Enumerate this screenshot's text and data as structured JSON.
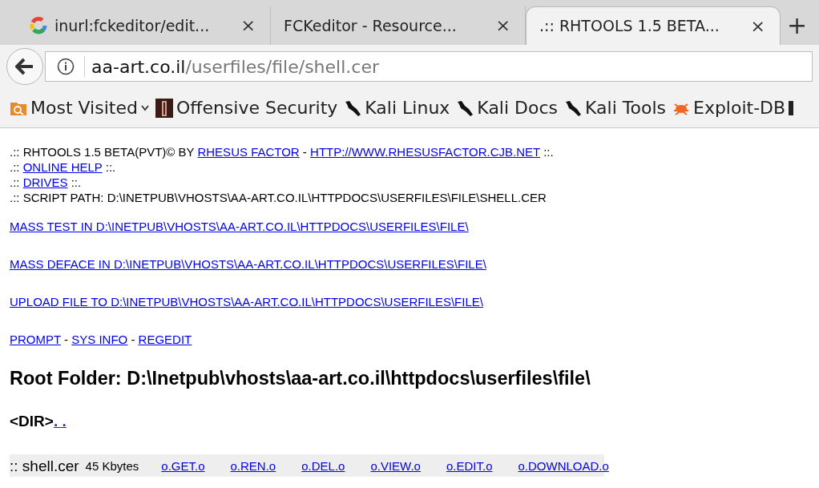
{
  "tabs": [
    {
      "title": "inurl:fckeditor/edit...",
      "kind": "ring",
      "close": "×",
      "selected": false
    },
    {
      "title": "FCKeditor - Resource...",
      "kind": "plain",
      "close": "×",
      "selected": false
    },
    {
      "title": ".:: RHTOOLS 1.5 BETA...",
      "kind": "plain",
      "close": "×",
      "selected": true
    }
  ],
  "new_tab": "+",
  "address_bar": {
    "host": "aa-art.co.il",
    "path": "/userfiles/file/shell.cer"
  },
  "bookmarks": [
    {
      "label": "Most Visited",
      "kind": "folder"
    },
    {
      "label": "Offensive Security",
      "kind": "thumbnail"
    },
    {
      "label": "Kali Linux",
      "kind": "dragon"
    },
    {
      "label": "Kali Docs",
      "kind": "dragon"
    },
    {
      "label": "Kali Tools",
      "kind": "dragon"
    },
    {
      "label": "Exploit-DB",
      "kind": "bug"
    }
  ],
  "page": {
    "header_lines": [
      [
        {
          "kind": "text",
          "text": ".:: RHTOOLS 1.5 BETA(PVT)© BY "
        },
        {
          "kind": "link",
          "text": "RHESUS FACTOR",
          "visited": false
        },
        {
          "kind": "text",
          "text": " - "
        },
        {
          "kind": "link",
          "text": "HTTP://WWW.RHESUSFACTOR.CJB.NET",
          "visited": false
        },
        {
          "kind": "text",
          "text": " ::."
        }
      ],
      [
        {
          "kind": "text",
          "text": ".:: "
        },
        {
          "kind": "link",
          "text": "ONLINE HELP",
          "visited": false
        },
        {
          "kind": "text",
          "text": " ::."
        }
      ],
      [
        {
          "kind": "text",
          "text": ".:: "
        },
        {
          "kind": "link",
          "text": "DRIVES",
          "visited": false
        },
        {
          "kind": "text",
          "text": " ::."
        }
      ],
      [
        {
          "kind": "text",
          "text": ".:: SCRIPT PATH: D:\\INETPUB\\VHOSTS\\AA-ART.CO.IL\\HTTPDOCS\\USERFILES\\FILE\\SHELL.CER"
        }
      ]
    ],
    "action_links": [
      {
        "text": "MASS TEST IN D:\\INETPUB\\VHOSTS\\AA-ART.CO.IL\\HTTPDOCS\\USERFILES\\FILE\\",
        "visited": false
      },
      {
        "text": "MASS DEFACE IN D:\\INETPUB\\VHOSTS\\AA-ART.CO.IL\\HTTPDOCS\\USERFILES\\FILE\\",
        "visited": false
      },
      {
        "text": "UPLOAD FILE TO D:\\INETPUB\\VHOSTS\\AA-ART.CO.IL\\HTTPDOCS\\USERFILES\\FILE\\",
        "visited": false
      }
    ],
    "tool_links": [
      {
        "kind": "link",
        "text": "PROMPT",
        "visited": false
      },
      {
        "kind": "text",
        "text": " - "
      },
      {
        "kind": "link",
        "text": "SYS INFO",
        "visited": false
      },
      {
        "kind": "text",
        "text": " - "
      },
      {
        "kind": "link",
        "text": "REGEDIT",
        "visited": false
      }
    ],
    "root_folder": "Root Folder: D:\\Inetpub\\vhosts\\aa-art.co.il\\httpdocs\\userfiles\\file\\",
    "dir_entry": {
      "label": "<DIR>",
      "link": ". .",
      "visited": true
    },
    "files": [
      {
        "name": ":: shell.cer",
        "size": "45 Kbytes",
        "actions": [
          {
            "text": "o.GET.o",
            "visited": false
          },
          {
            "text": "o.REN.o",
            "visited": false
          },
          {
            "text": "o.DEL.o",
            "visited": false
          },
          {
            "text": "o.VIEW.o",
            "visited": false
          },
          {
            "text": "o.EDIT.o",
            "visited": false
          },
          {
            "text": "o.DOWNLOAD.o",
            "visited": false
          }
        ]
      }
    ]
  }
}
